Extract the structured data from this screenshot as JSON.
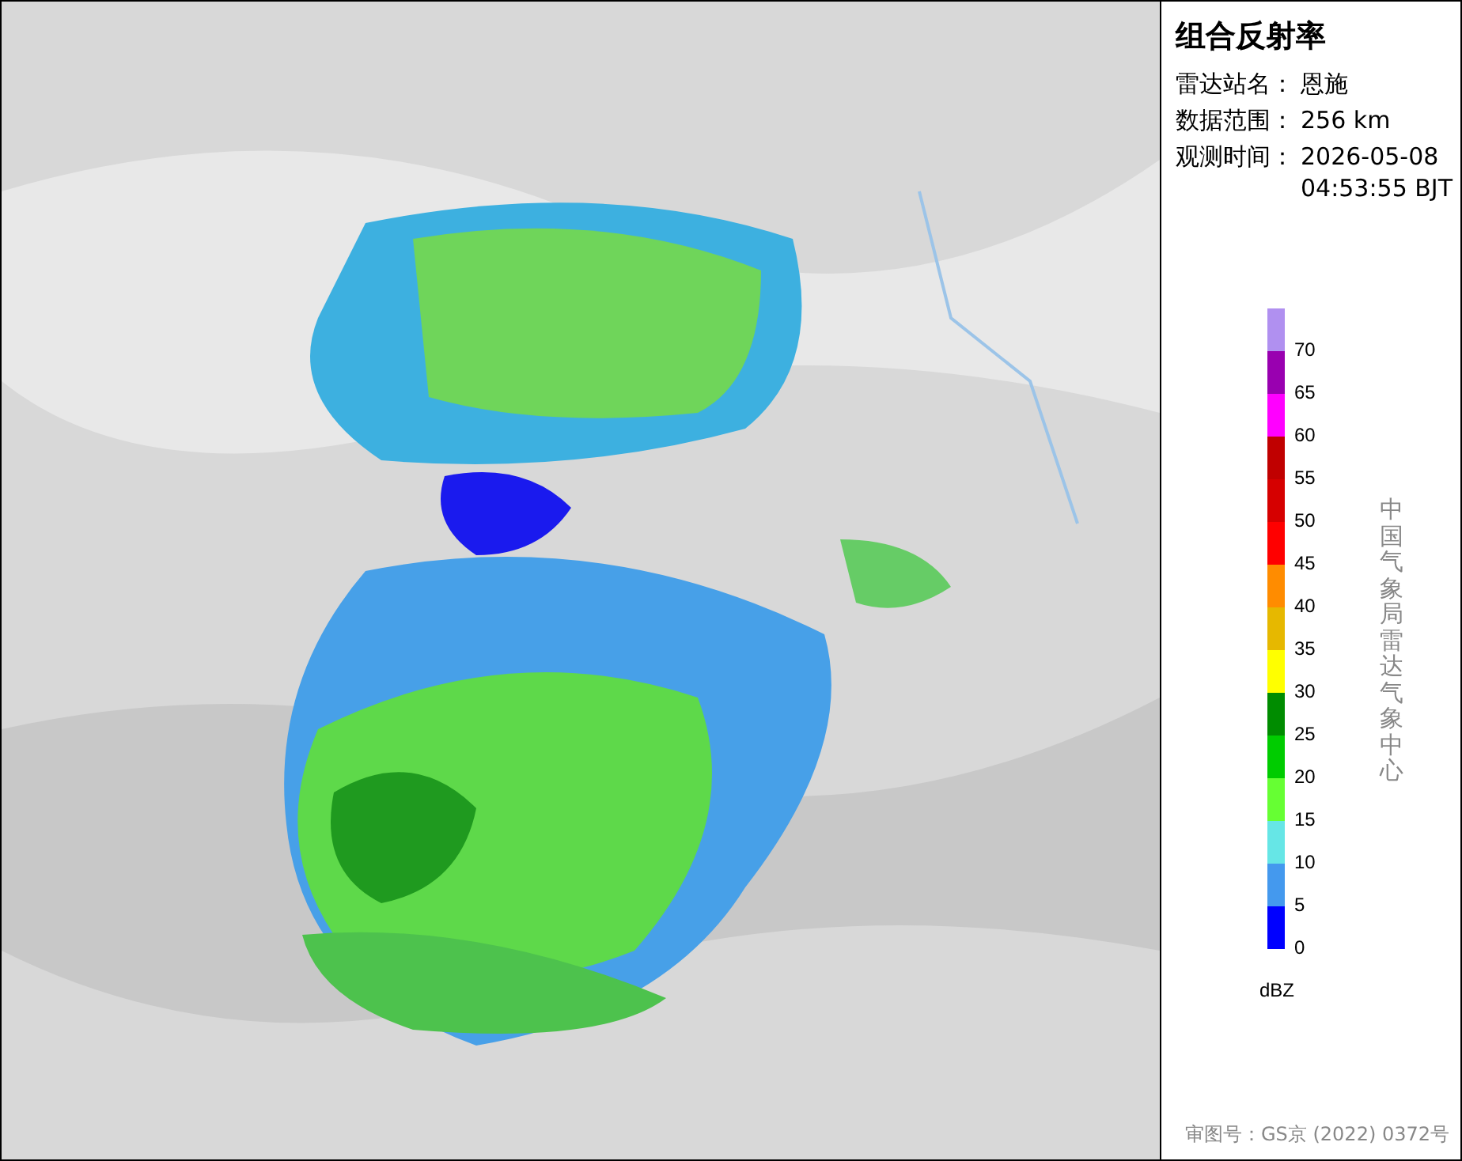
{
  "panel": {
    "title": "组合反射率",
    "fields": [
      {
        "label": "雷达站名：",
        "value": "恩施"
      },
      {
        "label": "数据范围：",
        "value": "256 km"
      },
      {
        "label": "观测时间：",
        "value": "2026-05-08 04:53:55 BJT"
      }
    ],
    "legend": [
      {
        "color": "#b090f0"
      },
      {
        "color": "#9900b0",
        "label": "70"
      },
      {
        "color": "#ff00ff",
        "label": "65"
      },
      {
        "color": "#c00000",
        "label": "60"
      },
      {
        "color": "#d60000",
        "label": "55"
      },
      {
        "color": "#ff0000",
        "label": "50"
      },
      {
        "color": "#ff8c00",
        "label": "45"
      },
      {
        "color": "#e6b800",
        "label": "40"
      },
      {
        "color": "#ffff00",
        "label": "35"
      },
      {
        "color": "#008c00",
        "label": "30"
      },
      {
        "color": "#00cc00",
        "label": "25"
      },
      {
        "color": "#66ff33",
        "label": "20"
      },
      {
        "color": "#66e6e6",
        "label": "15"
      },
      {
        "color": "#4499ee",
        "label": "10"
      },
      {
        "color": "#0000ff",
        "label": "5"
      }
    ],
    "legend_bottom_label": "0",
    "unit": "dBZ",
    "credit": "中国气象局雷达气象中心",
    "approval": "审图号：GS京 (2022) 0372号"
  }
}
